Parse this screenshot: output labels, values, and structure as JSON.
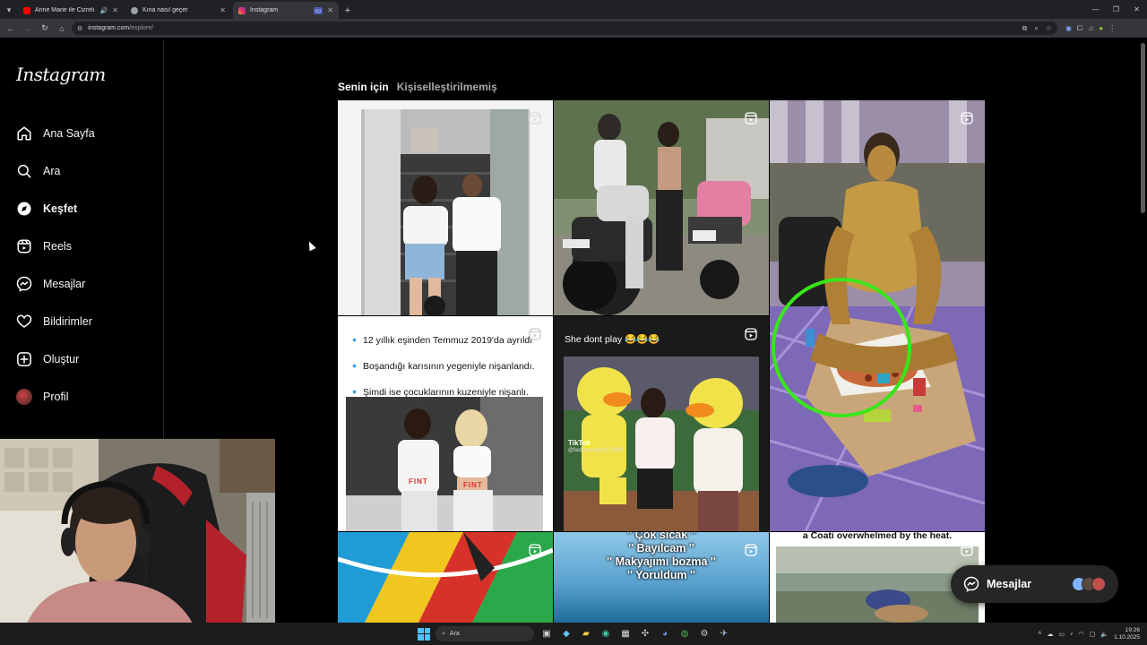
{
  "browser": {
    "tabs": [
      {
        "title": "Anne Marie ile Cizreli Meh",
        "favicon_color": "#ff0000",
        "active": false
      },
      {
        "title": "Kına nasıl geçer",
        "favicon_color": "#9aa0a6",
        "active": false
      },
      {
        "title": "Instagram",
        "favicon_color": "#e1306c",
        "active": true
      }
    ],
    "new_tab_glyph": "+",
    "url_host": "instagram.com",
    "url_path": "/explore/"
  },
  "sidebar": {
    "logo": "Instagram",
    "items": [
      {
        "label": "Ana Sayfa",
        "icon": "home-icon",
        "bold": false
      },
      {
        "label": "Ara",
        "icon": "search-icon",
        "bold": false
      },
      {
        "label": "Keşfet",
        "icon": "compass-icon",
        "bold": true
      },
      {
        "label": "Reels",
        "icon": "reels-icon",
        "bold": false
      },
      {
        "label": "Mesajlar",
        "icon": "messenger-icon",
        "bold": false
      },
      {
        "label": "Bildirimler",
        "icon": "heart-icon",
        "bold": false
      },
      {
        "label": "Oluştur",
        "icon": "plus-square-icon",
        "bold": false
      },
      {
        "label": "Profil",
        "icon": "avatar",
        "bold": false
      }
    ]
  },
  "explore": {
    "tabs": [
      {
        "label": "Senin için",
        "active": true
      },
      {
        "label": "Kişiselleştirilmemiş",
        "active": false
      }
    ],
    "posts": {
      "divorce_lines": [
        "12 yıllık eşinden Temmuz 2019'da ayrıldı",
        "Boşandığı karısının yegeniyle nişanlandı.",
        "Şimdi ise çocuklarının kuzeniyle nişanlı."
      ],
      "shirt_text": "FINT",
      "duck_caption": "She dont play 😂😂😂",
      "tiktok_label": "TikTok",
      "tiktok_handle": "@fashionnancy071989",
      "makeup_lines": [
        "'' Çok sıcak ''",
        "'' Bayılcam ''",
        "'' Makyajımı bozma ''",
        "'' Yoruldum ''"
      ],
      "coati_caption": "a Coati overwhelmed by the heat."
    }
  },
  "messages_pill": {
    "label": "Mesajlar"
  },
  "taskbar": {
    "search_placeholder": "Ara",
    "time": "19:26",
    "date": "1.10.2025"
  },
  "colors": {
    "accent_green_circle": "#39e61a",
    "background": "#000000",
    "muted_text": "#a8a8a8"
  }
}
